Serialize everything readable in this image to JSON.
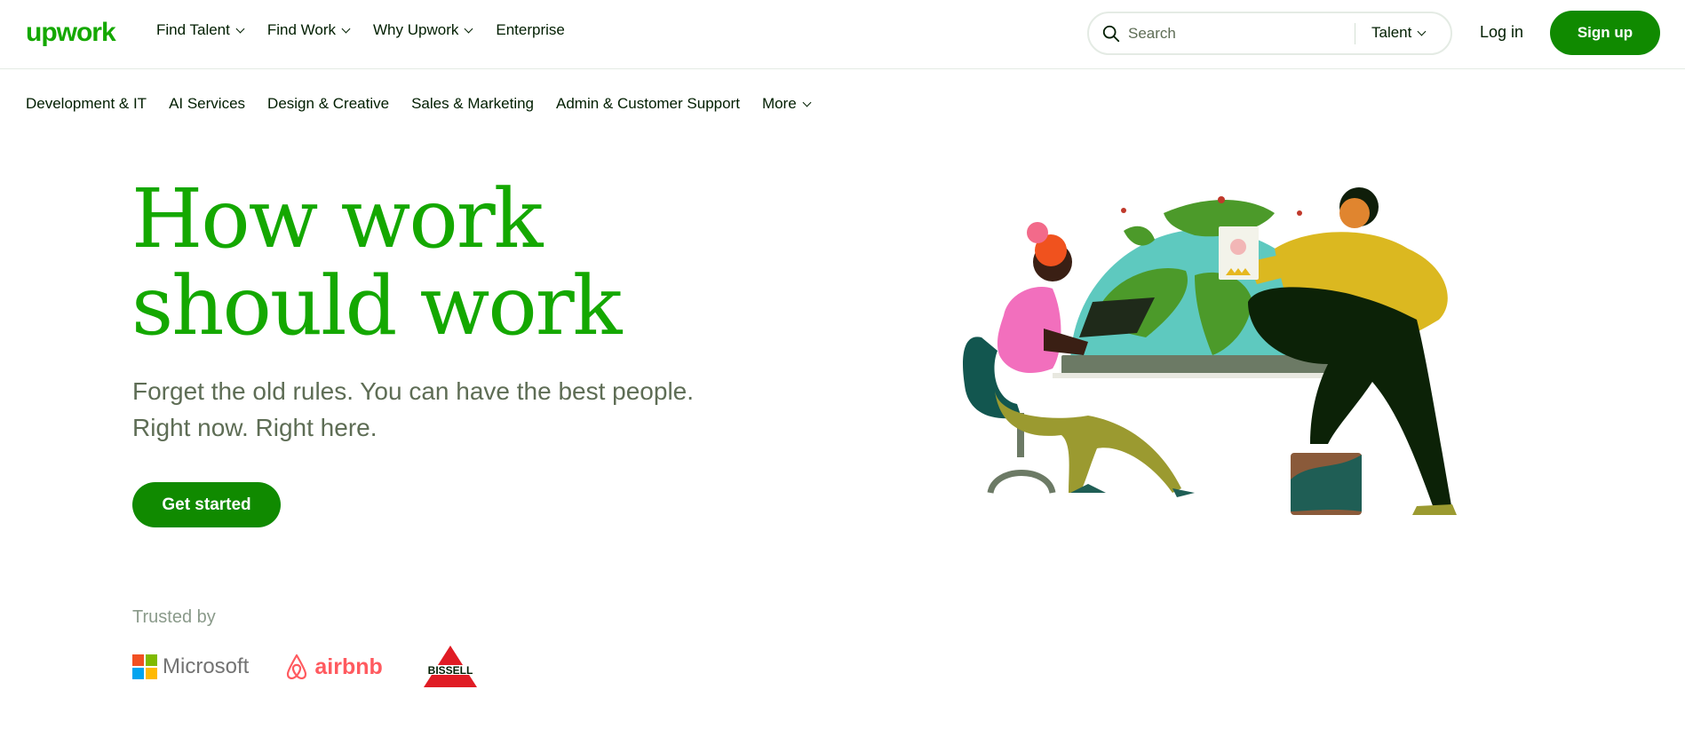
{
  "header": {
    "logo": "upwork",
    "nav": [
      {
        "label": "Find Talent",
        "dropdown": true
      },
      {
        "label": "Find Work",
        "dropdown": true
      },
      {
        "label": "Why Upwork",
        "dropdown": true
      },
      {
        "label": "Enterprise",
        "dropdown": false
      }
    ],
    "search": {
      "placeholder": "Search",
      "type_selected": "Talent"
    },
    "login_label": "Log in",
    "signup_label": "Sign up"
  },
  "categories": [
    "Development & IT",
    "AI Services",
    "Design & Creative",
    "Sales & Marketing",
    "Admin & Customer Support"
  ],
  "categories_more_label": "More",
  "hero": {
    "headline_line1": "How work",
    "headline_line2": "should work",
    "sub_line1": "Forget the old rules. You can have the best people.",
    "sub_line2": "Right now. Right here.",
    "cta_label": "Get started"
  },
  "trusted": {
    "label": "Trusted by",
    "logos": [
      "Microsoft",
      "airbnb",
      "BISSELL"
    ]
  },
  "colors": {
    "brand_green": "#14a800",
    "button_green": "#108a00",
    "text_dark": "#001e00",
    "text_muted": "#5e6d55"
  },
  "icons": {
    "search": "search-icon",
    "chevron": "chevron-down-icon"
  }
}
